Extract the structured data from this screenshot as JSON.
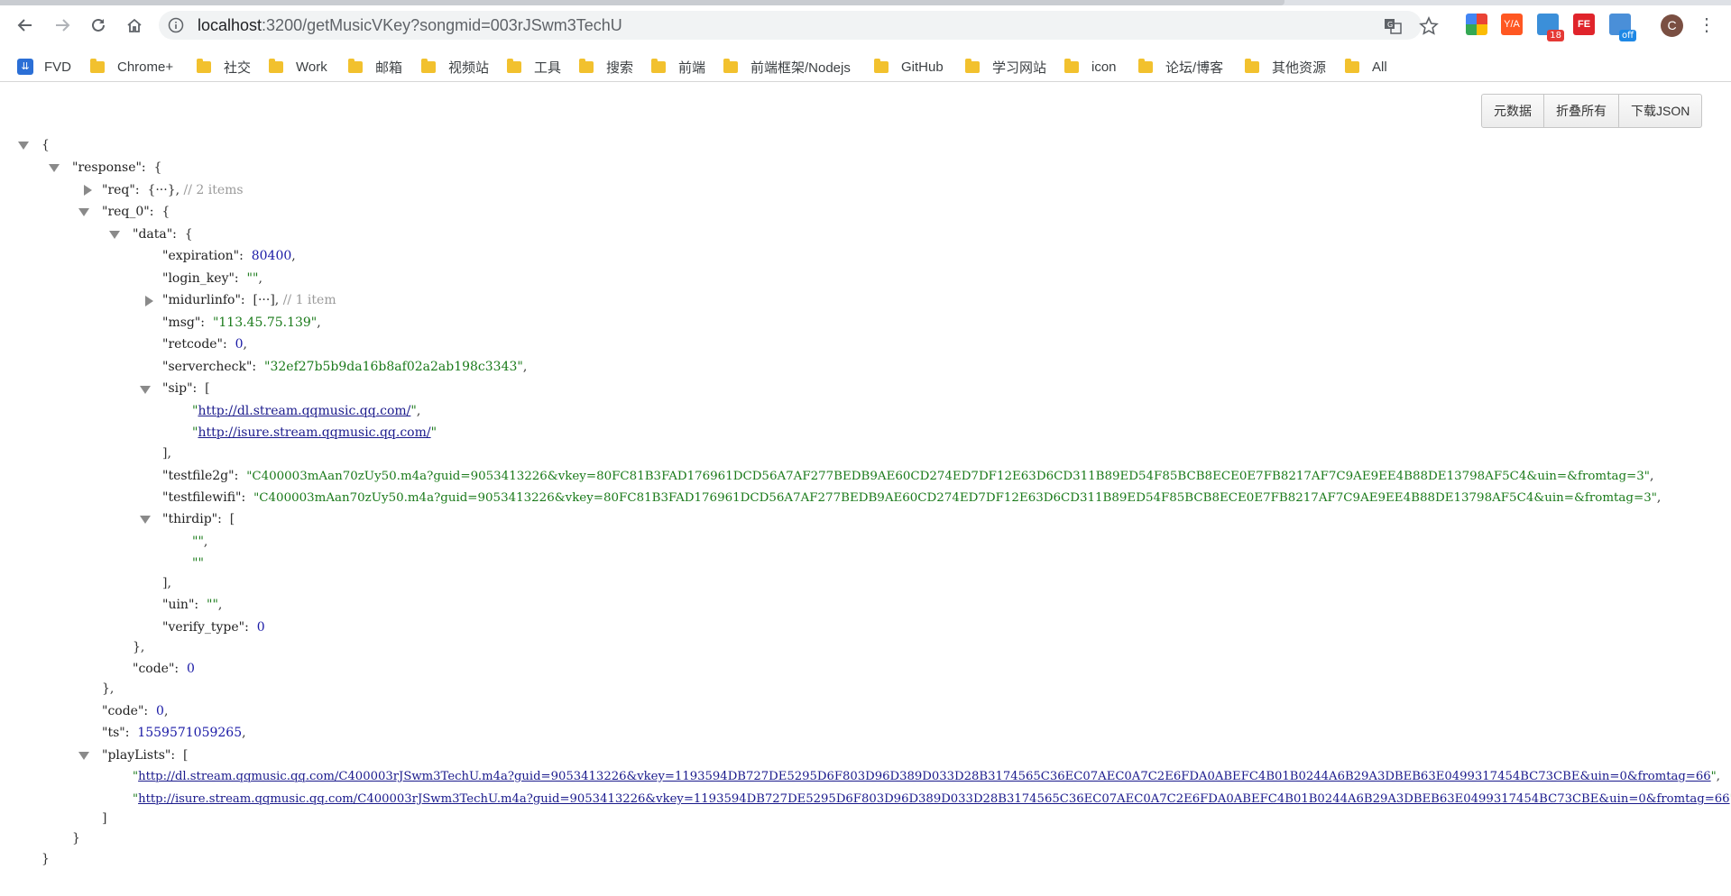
{
  "browser": {
    "url_host": "localhost",
    "url_path": ":3200/getMusicVKey?songmid=003rJSwm3TechU",
    "avatar_letter": "C",
    "extension_badges": [
      "18",
      "off"
    ]
  },
  "bookmarks": [
    "FVD",
    "Chrome+",
    "社交",
    "Work",
    "邮箱",
    "视频站",
    "工具",
    "搜索",
    "前端",
    "前端框架/Nodejs",
    "GitHub",
    "学习网站",
    "icon",
    "论坛/博客",
    "其他资源",
    "All"
  ],
  "viewer_buttons": [
    "元数据",
    "折叠所有",
    "下载JSON"
  ],
  "json": {
    "req_summary": "// 2 items",
    "midurlinfo_summary": "// 1 item",
    "expiration": "80400",
    "login_key": "\"\"",
    "msg": "\"113.45.75.139\"",
    "retcode": "0",
    "servercheck": "\"32ef27b5b9da16b8af02a2ab198c3343\"",
    "sip": [
      "http://dl.stream.qqmusic.qq.com/",
      "http://isure.stream.qqmusic.qq.com/"
    ],
    "testfile2g": "\"C400003mAan70zUy50.m4a?guid=9053413226&vkey=80FC81B3FAD176961DCD56A7AF277BEDB9AE60CD274ED7DF12E63D6CD311B89ED54F85BCB8ECE0E7FB8217AF7C9AE9EE4B88DE13798AF5C4&uin=&fromtag=3\"",
    "testfilewifi": "\"C400003mAan70zUy50.m4a?guid=9053413226&vkey=80FC81B3FAD176961DCD56A7AF277BEDB9AE60CD274ED7DF12E63D6CD311B89ED54F85BCB8ECE0E7FB8217AF7C9AE9EE4B88DE13798AF5C4&uin=&fromtag=3\"",
    "thirdip": [
      "\"\"",
      "\"\""
    ],
    "uin": "\"\"",
    "verify_type": "0",
    "req_0_code": "0",
    "response_code": "0",
    "ts": "1559571059265",
    "playLists": [
      "http://dl.stream.qqmusic.qq.com/C400003rJSwm3TechU.m4a?guid=9053413226&vkey=1193594DB727DE5295D6F803D96D389D033D28B3174565C36EC07AEC0A7C2E6FDA0ABEFC4B01B0244A6B29A3DBEB63E0499317454BC73CBE&uin=0&fromtag=66",
      "http://isure.stream.qqmusic.qq.com/C400003rJSwm3TechU.m4a?guid=9053413226&vkey=1193594DB727DE5295D6F803D96D389D033D28B3174565C36EC07AEC0A7C2E6FDA0ABEFC4B01B0244A6B29A3DBEB63E0499317454BC73CBE&uin=0&fromtag=66"
    ]
  }
}
